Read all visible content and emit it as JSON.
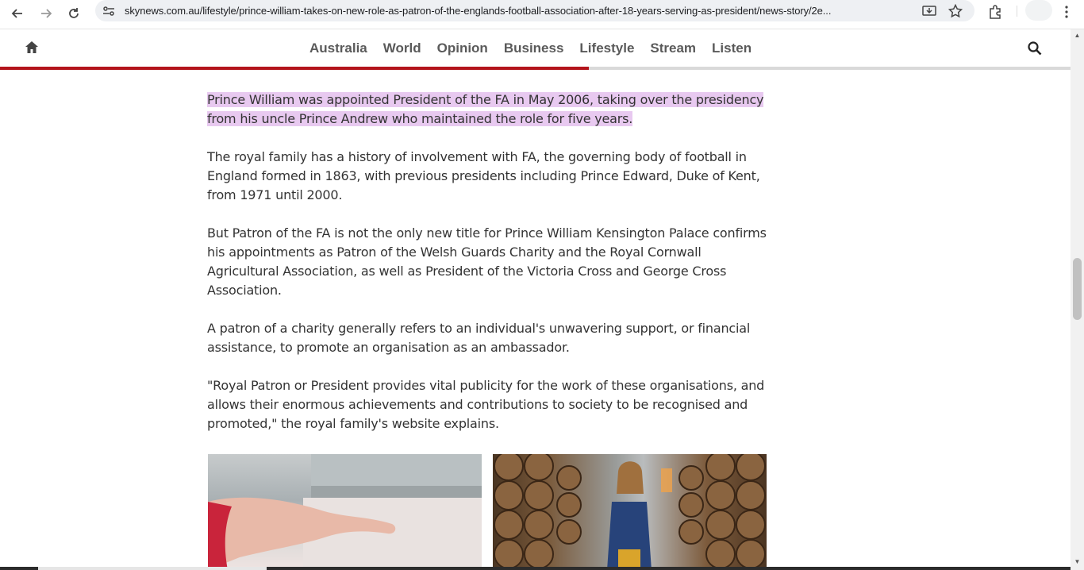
{
  "browser": {
    "url": "skynews.com.au/lifestyle/prince-william-takes-on-new-role-as-patron-of-the-englands-football-association-after-18-years-serving-as-president/news-story/2e...",
    "icons": [
      "back-arrow-icon",
      "forward-arrow-icon",
      "reload-icon",
      "site-settings-icon",
      "install-app-icon",
      "bookmark-star-icon",
      "extensions-icon",
      "kebab-menu-icon"
    ]
  },
  "header": {
    "nav": [
      {
        "label": "Australia"
      },
      {
        "label": "World"
      },
      {
        "label": "Opinion"
      },
      {
        "label": "Business"
      },
      {
        "label": "Lifestyle"
      },
      {
        "label": "Stream"
      },
      {
        "label": "Listen"
      }
    ],
    "reading_progress": 0.55,
    "accent_color": "#b3141b"
  },
  "article": {
    "paragraphs": [
      "Prince William was appointed President of the FA in May 2006, taking over the presidency from his uncle Prince Andrew who maintained the role for five years.",
      "The royal family has a history of involvement with FA, the governing body of football in England formed in 1863, with previous presidents including Prince Edward, Duke of Kent, from 1971 until 2000.",
      "But Patron of the FA is not the only new title for Prince William Kensington Palace confirms his appointments as Patron of the Welsh Guards Charity and the Royal Cornwall Agricultural Association, as well as President of the Victoria Cross and George Cross Association.",
      "A patron of a charity generally refers to an individual's unwavering support, or financial assistance, to promote an organisation as an ambassador.",
      "\"Royal Patron or President provides vital publicity for the work of these organisations, and allows their enormous achievements and contributions to society to be recognised and promoted,\" the royal family's website explains."
    ],
    "highlight_color": "#e8c9f0"
  }
}
